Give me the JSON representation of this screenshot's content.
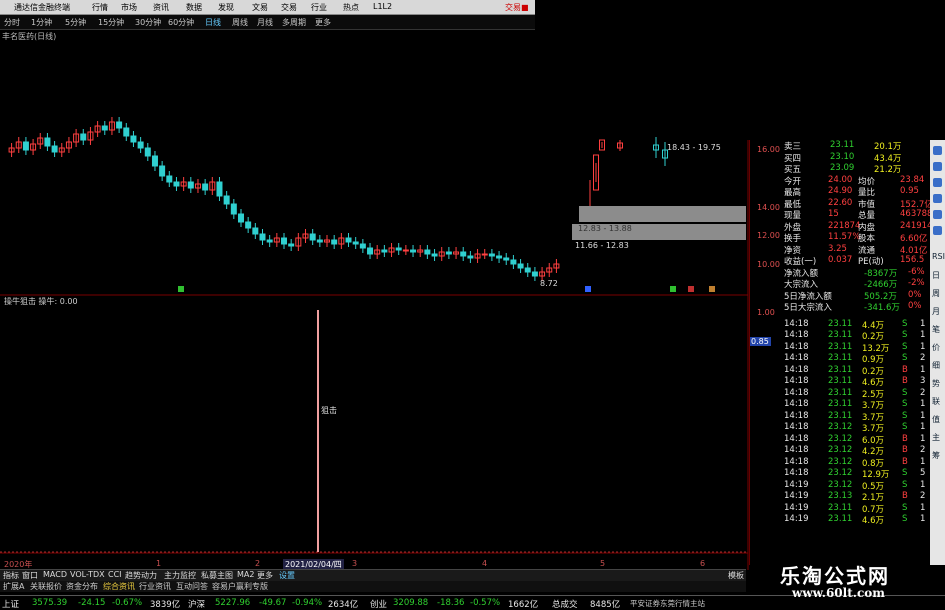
{
  "title_bar": {
    "app_name": "通达信金融终端",
    "menus": [
      "行情",
      "市场",
      "资讯",
      "数据",
      "发现",
      "文易",
      "交易",
      "行业",
      "热点",
      "L1L2"
    ],
    "right_button": "交易■"
  },
  "period_bar": {
    "items": [
      "分时",
      "1分钟",
      "5分钟",
      "15分钟",
      "30分钟",
      "60分钟",
      "日线",
      "周线",
      "月线",
      "多周期",
      "更多"
    ]
  },
  "stock_label": "丰名医药(日线)",
  "main_chart_labels": {
    "range_tag_1": "18.43 - 19.75",
    "range_tag_2": "12.83 - 13.88",
    "range_tag_3": "11.66 - 12.83",
    "low_tag": "8.72"
  },
  "main_axis_ticks": [
    "16.00",
    "14.00",
    "12.00",
    "10.00"
  ],
  "indicator_title": "操牛狙击  操牛: 0.00",
  "indicator_axis_ticks": [
    "1.00",
    "0.85"
  ],
  "sniper_label": "狙击",
  "timeline": {
    "year_label": "2020年",
    "selected_date": "2021/02/04/四",
    "ticks": [
      "1",
      "2",
      "3",
      "4",
      "5",
      "6"
    ]
  },
  "quote_panel": {
    "asks": [
      {
        "label": "卖三",
        "price": "23.11",
        "vol": "20.1万"
      },
      {
        "label": "买四",
        "price": "23.10",
        "vol": "43.4万"
      },
      {
        "label": "买五",
        "price": "23.09",
        "vol": "21.2万"
      }
    ],
    "stats": [
      {
        "l1": "今开",
        "v1": "24.00",
        "l2": "均价",
        "v2": "23.84"
      },
      {
        "l1": "最高",
        "v1": "24.90",
        "l2": "量比",
        "v2": "0.95"
      },
      {
        "l1": "最低",
        "v1": "22.60",
        "l2": "市值",
        "v2": "152.7亿"
      },
      {
        "l1": "现量",
        "v1": "15",
        "l2": "总量",
        "v2": "463788"
      },
      {
        "l1": "外盘",
        "v1": "221874",
        "l2": "内盘",
        "v2": "241914"
      },
      {
        "l1": "换手",
        "v1": "11.57%",
        "l2": "股本",
        "v2": "6.60亿"
      },
      {
        "l1": "净资",
        "v1": "3.25",
        "l2": "流通",
        "v2": "4.01亿"
      },
      {
        "l1": "收益(一)",
        "v1": "0.037",
        "l2": "PE(动)",
        "v2": "156.5"
      }
    ],
    "flows": [
      {
        "label": "净流入额",
        "val": "-8367万",
        "pct": "-6%"
      },
      {
        "label": "大宗流入",
        "val": "-2466万",
        "pct": "-2%"
      },
      {
        "label": "5日净流入额",
        "val": "505.2万",
        "pct": "0%"
      },
      {
        "label": "5日大宗流入",
        "val": "-341.6万",
        "pct": "0%"
      }
    ],
    "ticks": [
      {
        "time": "14:18",
        "price": "23.11",
        "vol": "4.4万",
        "bs": "S",
        "n": "1"
      },
      {
        "time": "14:18",
        "price": "23.11",
        "vol": "0.2万",
        "bs": "S",
        "n": "1"
      },
      {
        "time": "14:18",
        "price": "23.11",
        "vol": "13.2万",
        "bs": "S",
        "n": "1"
      },
      {
        "time": "14:18",
        "price": "23.11",
        "vol": "0.9万",
        "bs": "S",
        "n": "2"
      },
      {
        "time": "14:18",
        "price": "23.11",
        "vol": "0.2万",
        "bs": "B",
        "n": "1"
      },
      {
        "time": "14:18",
        "price": "23.11",
        "vol": "4.6万",
        "bs": "B",
        "n": "3"
      },
      {
        "time": "14:18",
        "price": "23.11",
        "vol": "2.5万",
        "bs": "S",
        "n": "2"
      },
      {
        "time": "14:18",
        "price": "23.11",
        "vol": "3.7万",
        "bs": "S",
        "n": "1"
      },
      {
        "time": "14:18",
        "price": "23.11",
        "vol": "3.7万",
        "bs": "S",
        "n": "1"
      },
      {
        "time": "14:18",
        "price": "23.12",
        "vol": "3.7万",
        "bs": "S",
        "n": "1"
      },
      {
        "time": "14:18",
        "price": "23.12",
        "vol": "6.0万",
        "bs": "B",
        "n": "1"
      },
      {
        "time": "14:18",
        "price": "23.12",
        "vol": "4.2万",
        "bs": "B",
        "n": "2"
      },
      {
        "time": "14:18",
        "price": "23.12",
        "vol": "0.8万",
        "bs": "B",
        "n": "1"
      },
      {
        "time": "14:18",
        "price": "23.12",
        "vol": "12.9万",
        "bs": "S",
        "n": "5"
      },
      {
        "time": "14:19",
        "price": "23.12",
        "vol": "0.5万",
        "bs": "S",
        "n": "1"
      },
      {
        "time": "14:19",
        "price": "23.13",
        "vol": "2.1万",
        "bs": "B",
        "n": "2"
      },
      {
        "time": "14:19",
        "price": "23.11",
        "vol": "0.7万",
        "bs": "S",
        "n": "1"
      },
      {
        "time": "14:19",
        "price": "23.11",
        "vol": "4.6万",
        "bs": "S",
        "n": "1"
      }
    ]
  },
  "side_tabs": [
    "RSI",
    "日",
    "周",
    "月",
    "笔",
    "价",
    "细",
    "势",
    "联",
    "值",
    "主",
    "筹"
  ],
  "indicator_bar": [
    "指标",
    "窗口",
    "MACD",
    "VOL-TDX",
    "CCI",
    "趋势动力",
    "主力监控",
    "私募主图",
    "MA2",
    "更多",
    "设置"
  ],
  "indicator_bar_right": "模板",
  "category_bar": [
    "扩展A",
    "关联报价",
    "资金分布",
    "综合资讯",
    "行业资讯",
    "互动问答",
    "容易户赢利专版"
  ],
  "status_bar": {
    "items": [
      {
        "name": "上证",
        "val": "3575.39",
        "chg": "-24.15",
        "pct": "-0.67%",
        "amt": "3839亿"
      },
      {
        "name": "沪深",
        "val": "5227.96",
        "chg": "-49.67",
        "pct": "-0.94%",
        "amt": "2634亿"
      },
      {
        "name": "创业",
        "val": "3209.88",
        "chg": "-18.36",
        "pct": "-0.57%",
        "amt": "1662亿"
      }
    ],
    "total_label": "总成交",
    "total_val": "8485亿",
    "broker": "平安证券东莞行情主站"
  },
  "brand": {
    "title": "乐淘公式网",
    "url": "www.60lt.com"
  },
  "colors": {
    "up": "#ff4040",
    "down": "#30d0d0",
    "bg": "#000000",
    "grid": "#600000"
  },
  "chart_data": {
    "type": "candlestick",
    "values_close": [
      15.6,
      15.9,
      15.5,
      15.8,
      16.1,
      15.7,
      15.4,
      15.6,
      15.9,
      16.3,
      16.0,
      16.4,
      16.7,
      16.5,
      16.9,
      16.6,
      16.2,
      15.9,
      15.6,
      15.2,
      14.7,
      14.2,
      13.9,
      13.7,
      13.9,
      13.6,
      13.8,
      13.5,
      13.9,
      13.2,
      12.8,
      12.3,
      11.9,
      11.6,
      11.3,
      11.0,
      10.9,
      11.1,
      10.8,
      10.7,
      11.1,
      11.3,
      11.0,
      10.9,
      11.0,
      10.8,
      11.1,
      10.9,
      10.8,
      10.6,
      10.3,
      10.5,
      10.4,
      10.6,
      10.5,
      10.5,
      10.4,
      10.5,
      10.3,
      10.2,
      10.4,
      10.3,
      10.4,
      10.2,
      10.1,
      10.3,
      10.3,
      10.2,
      10.1,
      10.0,
      9.8,
      9.6,
      9.4,
      9.2,
      9.4,
      9.6,
      9.8
    ],
    "values_open": [
      15.4,
      15.6,
      15.9,
      15.5,
      15.8,
      16.1,
      15.7,
      15.4,
      15.6,
      15.9,
      16.3,
      16.0,
      16.4,
      16.7,
      16.5,
      16.9,
      16.6,
      16.2,
      15.9,
      15.6,
      15.2,
      14.7,
      14.2,
      13.9,
      13.7,
      13.9,
      13.6,
      13.8,
      13.5,
      13.9,
      13.2,
      12.8,
      12.3,
      11.9,
      11.6,
      11.3,
      11.0,
      10.9,
      11.1,
      10.8,
      10.7,
      11.1,
      11.3,
      11.0,
      10.9,
      11.0,
      10.8,
      11.1,
      10.9,
      10.8,
      10.6,
      10.3,
      10.5,
      10.4,
      10.6,
      10.5,
      10.5,
      10.4,
      10.5,
      10.3,
      10.2,
      10.4,
      10.3,
      10.4,
      10.2,
      10.1,
      10.3,
      10.3,
      10.2,
      10.1,
      10.0,
      9.8,
      9.6,
      9.4,
      9.2,
      9.4,
      9.6
    ],
    "ylim": [
      8.5,
      17.5
    ]
  }
}
